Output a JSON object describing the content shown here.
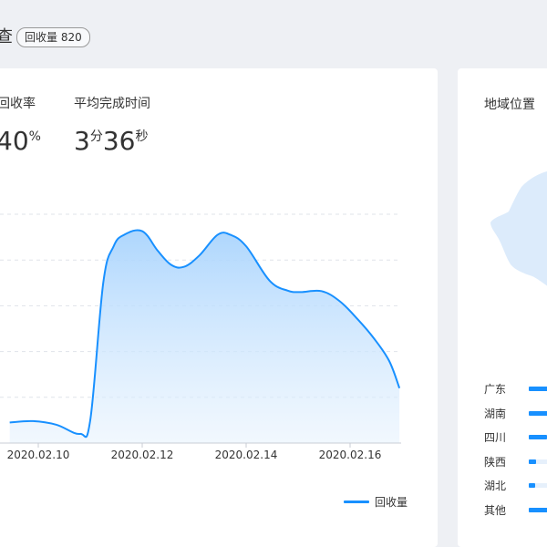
{
  "header": {
    "title_fragment": "查",
    "badge": "回收量 820"
  },
  "stats": {
    "recovery_rate_label_fragment": "回收率",
    "recovery_rate_value_fragment": "40",
    "recovery_rate_unit": "%",
    "avg_time_label": "平均完成时间",
    "avg_time_minutes": "3",
    "avg_time_minutes_unit": "分",
    "avg_time_seconds": "36",
    "avg_time_seconds_unit": "秒"
  },
  "chart_data": {
    "type": "area",
    "x_tick_labels": [
      "2020.02.10",
      "2020.02.12",
      "2020.02.14",
      "2020.02.16"
    ],
    "x": [
      9.45,
      9.9,
      10.35,
      10.8,
      11.0,
      11.25,
      11.45,
      11.65,
      12.0,
      12.3,
      12.55,
      12.8,
      13.1,
      13.45,
      13.7,
      14.0,
      14.45,
      14.8,
      15.05,
      15.45,
      15.8,
      16.15,
      16.45,
      16.75,
      16.95
    ],
    "y": [
      0.45,
      0.48,
      0.4,
      0.2,
      0.5,
      3.5,
      4.3,
      4.55,
      4.63,
      4.2,
      3.9,
      3.85,
      4.1,
      4.55,
      4.55,
      4.3,
      3.55,
      3.33,
      3.3,
      3.32,
      3.1,
      2.7,
      2.3,
      1.8,
      1.2
    ],
    "xlim": [
      9.45,
      16.95
    ],
    "ylim": [
      0,
      5
    ],
    "legend": [
      "回收量"
    ],
    "legend_position": "bottom-right",
    "grid": true,
    "color": "#1890ff"
  },
  "region": {
    "title": "地域位置",
    "items": [
      {
        "name": "广东",
        "share": 0.92
      },
      {
        "name": "湖南",
        "share": 0.88
      },
      {
        "name": "四川",
        "share": 0.85
      },
      {
        "name": "陕西",
        "share": 0.32
      },
      {
        "name": "湖北",
        "share": 0.3
      },
      {
        "name": "其他",
        "share": 0.86
      }
    ]
  }
}
